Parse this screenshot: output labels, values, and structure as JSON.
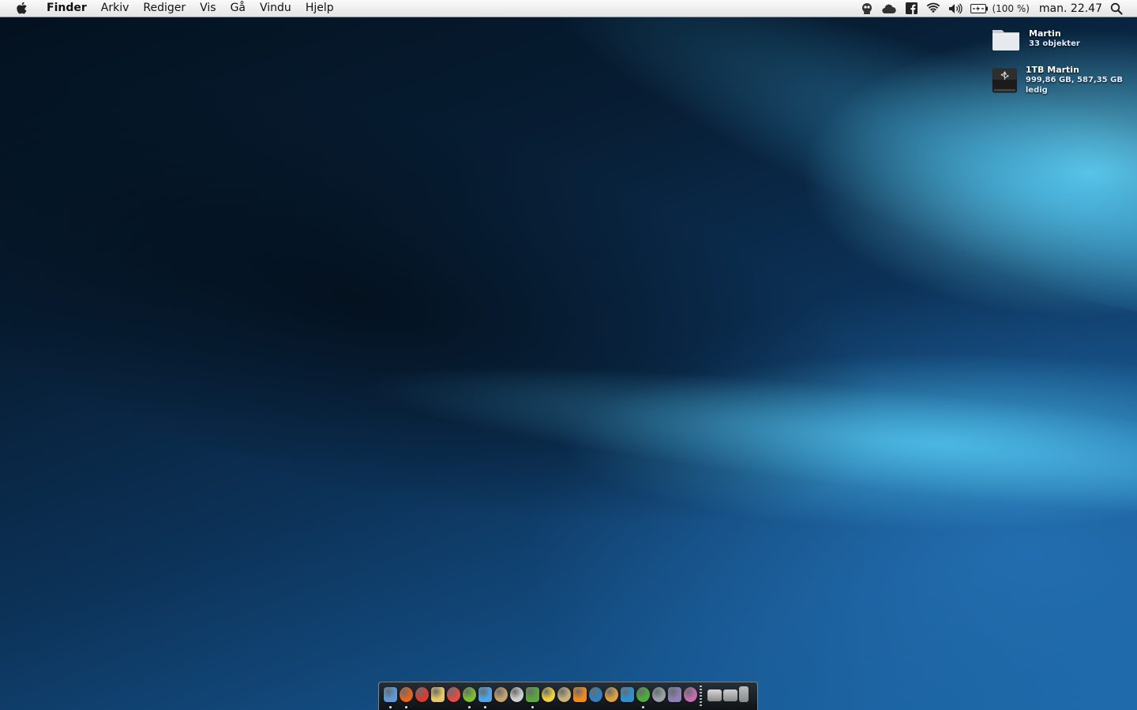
{
  "menubar": {
    "app_name": "Finder",
    "menus": [
      "Arkiv",
      "Rediger",
      "Vis",
      "Gå",
      "Vindu",
      "Hjelp"
    ],
    "battery_percent": "(100 %)",
    "clock": "man. 22.47",
    "status_icons": [
      "alien-robot-icon",
      "cloud-icon",
      "facebook-icon",
      "wifi-icon",
      "volume-icon",
      "battery-icon",
      "spotlight-search-icon"
    ]
  },
  "desktop_icons": [
    {
      "name": "Martin",
      "info": "33 objekter",
      "icon": "folder-icon"
    },
    {
      "name": "1TB Martin",
      "info": "999,86 GB, 587,35 GB ledig",
      "icon": "usb-drive-icon"
    }
  ],
  "dock": {
    "apps": [
      {
        "icon": "finder-icon",
        "color": "#5b9bd5",
        "running": true
      },
      {
        "icon": "firefox-icon",
        "color": "#e8641b",
        "running": true
      },
      {
        "icon": "chrome-icon",
        "color": "#dd3b2f",
        "running": false
      },
      {
        "icon": "notes-icon",
        "color": "#e8c768",
        "running": false
      },
      {
        "icon": "ical-icon",
        "color": "#e54b43",
        "running": false
      },
      {
        "icon": "spotify-icon",
        "color": "#7cbf2f",
        "running": true
      },
      {
        "icon": "itunes-icon",
        "color": "#4fa4e8",
        "running": true
      },
      {
        "icon": "iphoto-icon",
        "color": "#c9a26b",
        "running": false
      },
      {
        "icon": "imovie-icon",
        "color": "#cfcfcf",
        "running": false
      },
      {
        "icon": "adium-icon",
        "color": "#5aa83b",
        "running": true
      },
      {
        "icon": "mail-icon",
        "color": "#f2d13a",
        "running": false
      },
      {
        "icon": "yojimbo-icon",
        "color": "#c8b27a",
        "running": false
      },
      {
        "icon": "vlc-icon",
        "color": "#f08a1c",
        "running": false
      },
      {
        "icon": "photoshop-icon",
        "color": "#2f7fc1",
        "running": false
      },
      {
        "icon": "transmit-icon",
        "color": "#e0a040",
        "running": false
      },
      {
        "icon": "word-icon",
        "color": "#2f8fd0",
        "running": false
      },
      {
        "icon": "utorrent-icon",
        "color": "#4cae3a",
        "running": true
      },
      {
        "icon": "system-preferences-icon",
        "color": "#9aa0a6",
        "running": false
      },
      {
        "icon": "display-icon",
        "color": "#8e7fb4",
        "running": false
      },
      {
        "icon": "clapper-icon",
        "color": "#c86ab0",
        "running": false
      }
    ],
    "stacks": [
      {
        "icon": "applications-folder-icon",
        "color": "#d9d9d9"
      },
      {
        "icon": "downloads-folder-icon",
        "color": "#cfcfcf"
      },
      {
        "icon": "trash-icon",
        "color": "#bdbdbd"
      }
    ]
  }
}
